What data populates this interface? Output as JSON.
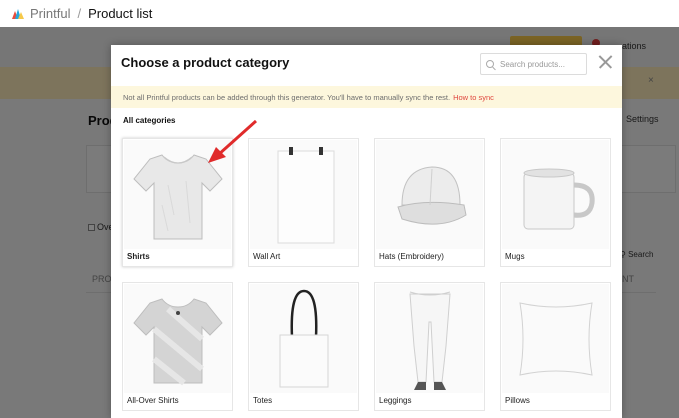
{
  "breadcrumb": {
    "root": "Printful",
    "separator": "/",
    "current": "Product list"
  },
  "background": {
    "heading": "Prod",
    "settings_label": "Settings",
    "actions_label": "ations",
    "banner_close": "×",
    "overwrite_label": "Ove",
    "search_label": "Search",
    "col_left": "PRO",
    "col_right": "NT"
  },
  "modal": {
    "title": "Choose a product category",
    "search_placeholder": "Search products...",
    "notice_text": "Not all Printful products can be added through this generator. You'll have to manually sync the rest.",
    "notice_link": "How to sync",
    "section_title": "All categories",
    "categories": [
      {
        "label": "Shirts",
        "icon": "t-shirt-icon",
        "selected": true
      },
      {
        "label": "Wall Art",
        "icon": "poster-icon"
      },
      {
        "label": "Hats (Embroidery)",
        "icon": "cap-icon"
      },
      {
        "label": "Mugs",
        "icon": "mug-icon"
      },
      {
        "label": "All-Over Shirts",
        "icon": "all-over-shirt-icon"
      },
      {
        "label": "Totes",
        "icon": "tote-bag-icon"
      },
      {
        "label": "Leggings",
        "icon": "leggings-icon"
      },
      {
        "label": "Pillows",
        "icon": "pillow-icon"
      }
    ]
  },
  "colors": {
    "accent_red": "#e0463d",
    "notice_bg": "#fdf7dd",
    "brand_yellow": "#f6c94a"
  }
}
